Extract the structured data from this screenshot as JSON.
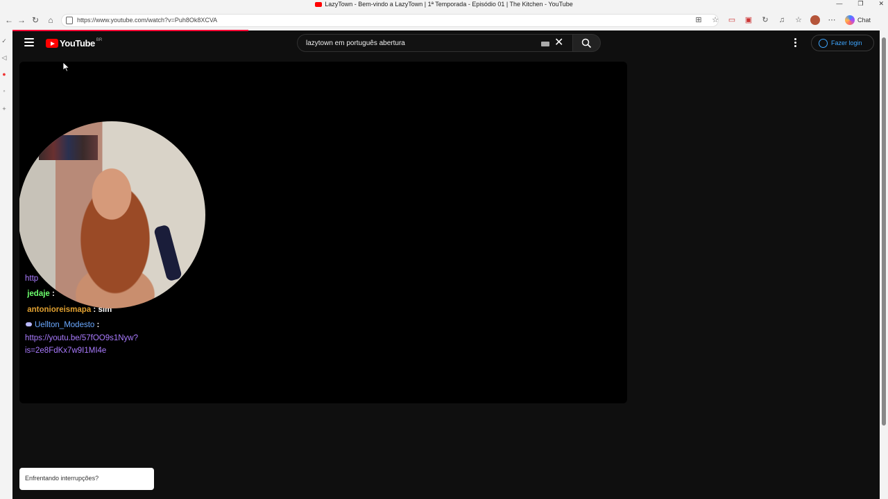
{
  "window": {
    "title": "LazyTown - Bem-vindo a LazyTown | 1ª Temporada - Episódio 01 | The Kitchen - YouTube",
    "controls": [
      "—",
      "❐",
      "✕"
    ]
  },
  "browser": {
    "url": "https://www.youtube.com/watch?v=Puh8Ok8XCVA",
    "copilot_label": "Chat",
    "nav": {
      "back": "←",
      "forward": "→",
      "reload": "↻",
      "home": "⌂"
    },
    "toolbar_icons": [
      "⊞",
      "☆",
      "▭",
      "▣",
      "↻",
      "♫",
      "☆",
      "⋯"
    ]
  },
  "youtube": {
    "logo_text": "YouTube",
    "region": "BR",
    "search_value": "lazytown em português abertura",
    "login_label": "Fazer login"
  },
  "chat": {
    "line1_partial": "http",
    "line2_name": "jedaje",
    "line2_sep": " :",
    "line3_name": "antonioreismapa",
    "line3_msg": " : sim",
    "line4_name": "Uellton_Modesto",
    "line4_sep": " :",
    "line5_link1": "https://youtu.be/57fOO9s1Nyw?",
    "line5_link2": "is=2e8FdKx7w9I1MI4e"
  },
  "toast": {
    "text": "Enfrentando interrupções?"
  },
  "colors": {
    "accent": "#ff0000",
    "link_blue": "#3ea6ff",
    "bg": "#0f0f0f"
  }
}
